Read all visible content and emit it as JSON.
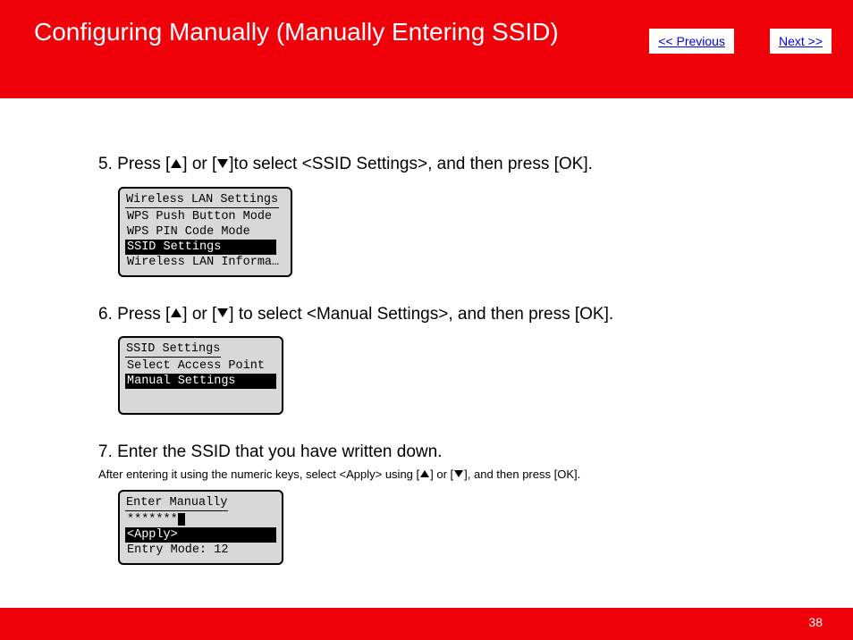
{
  "header": {
    "title": "Configuring Manually (Manually Entering SSID)",
    "prev": "<< Previous",
    "next": "Next >>"
  },
  "step5": {
    "num": "5.",
    "pre": "Press [",
    "mid1": "] or [",
    "post": "]to select <SSID Settings>, and then press [OK].",
    "lcd_title": "Wireless LAN Settings",
    "r1": "WPS Push Button Mode",
    "r2": "WPS PIN Code Mode",
    "r3": "SSID Settings",
    "r4": "Wireless LAN Informa…"
  },
  "step6": {
    "num": "6.",
    "pre": "Press [",
    "mid1": "] or [",
    "post": "] to select <Manual Settings>, and then press [OK].",
    "lcd_title": "SSID Settings",
    "r1": "Select Access Point",
    "r2": "Manual Settings"
  },
  "step7": {
    "num": "7.",
    "text": "Enter the SSID that you have written down.",
    "note_pre": "After entering it using the numeric keys, select <Apply> using [",
    "note_mid": "] or [",
    "note_post": "], and then press [OK].",
    "lcd_title": "Enter Manually",
    "masked": "*******",
    "apply": "<Apply>",
    "entry": "Entry Mode: 12"
  },
  "footer": {
    "page": "38"
  }
}
